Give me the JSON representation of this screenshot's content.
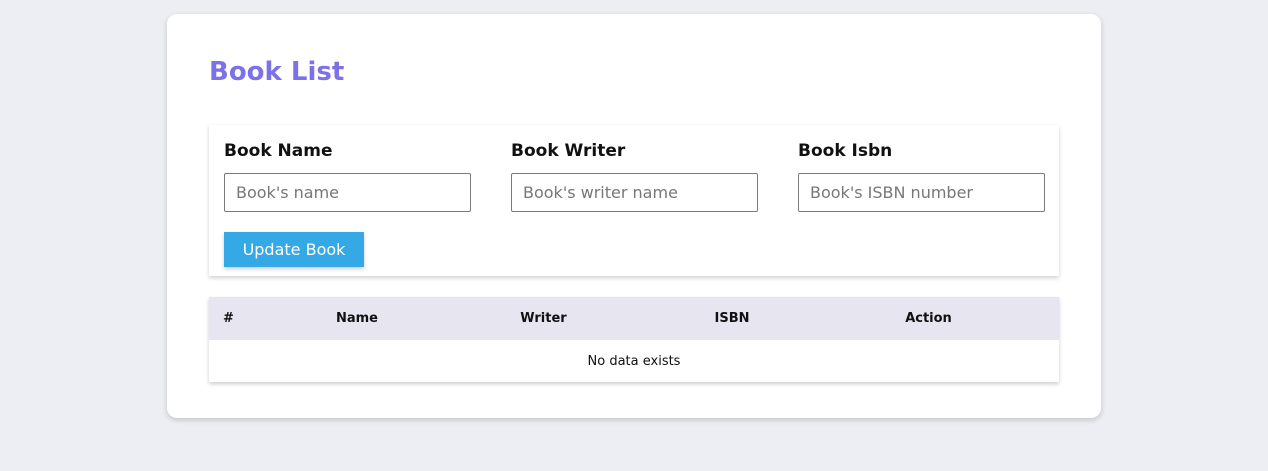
{
  "page": {
    "title": "Book List"
  },
  "form": {
    "fields": [
      {
        "label": "Book Name",
        "placeholder": "Book's name",
        "value": ""
      },
      {
        "label": "Book Writer",
        "placeholder": "Book's writer name",
        "value": ""
      },
      {
        "label": "Book Isbn",
        "placeholder": "Book's ISBN number",
        "value": ""
      }
    ],
    "submit_label": "Update Book"
  },
  "table": {
    "columns": [
      "#",
      "Name",
      "Writer",
      "ISBN",
      "Action"
    ],
    "rows": [],
    "empty_message": "No data exists"
  },
  "colors": {
    "background": "#edeef3",
    "title": "#7b72ea",
    "button": "#35a8e6",
    "table_header": "#e7e5ef"
  }
}
